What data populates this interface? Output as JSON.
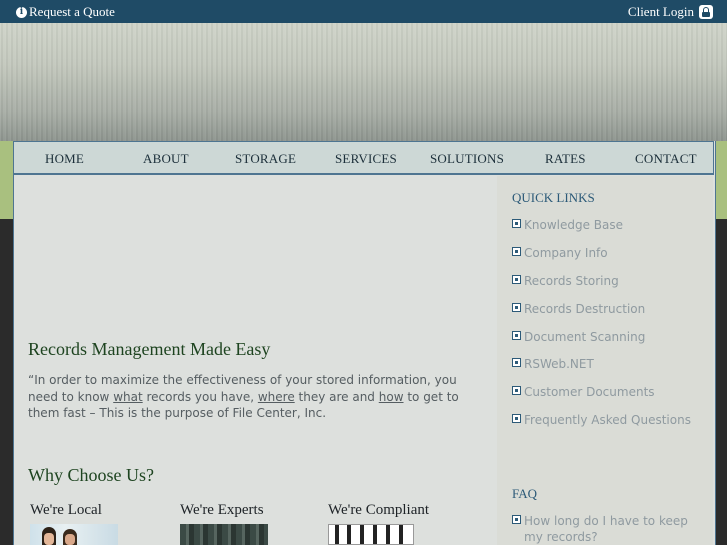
{
  "topbar": {
    "quote_label": "Request a Quote",
    "login_label": "Client Login"
  },
  "nav": {
    "items": [
      "HOME",
      "ABOUT",
      "STORAGE",
      "SERVICES",
      "SOLUTIONS",
      "RATES",
      "CONTACT"
    ]
  },
  "main": {
    "title": "Records Management Made Easy",
    "quote": {
      "part1": "“In order to maximize the effectiveness of your stored information, you need to know ",
      "what": "what",
      "part2": " records you have, ",
      "where": "where",
      "part3": " they are and ",
      "how": "how",
      "part4": " to get to them fast – This is the purpose of File Center, Inc."
    },
    "why_title": "Why Choose Us?",
    "features": [
      "We're Local",
      "We're Experts",
      "We're Compliant"
    ]
  },
  "sidebar": {
    "quick_links_title": "QUICK LINKS",
    "links": [
      "Knowledge Base",
      "Company Info",
      "Records Storing",
      "Records Destruction",
      "Document Scanning",
      "RSWeb.NET",
      "Customer Documents",
      "Frequently Asked Questions"
    ],
    "faq_title": "FAQ",
    "faq_item": "How long do I have to keep my records?"
  },
  "colors": {
    "topbar": "#1f4b66",
    "accent_green": "#a9c07f",
    "heading_green": "#1e4420",
    "link_blue": "#2c5a78"
  }
}
